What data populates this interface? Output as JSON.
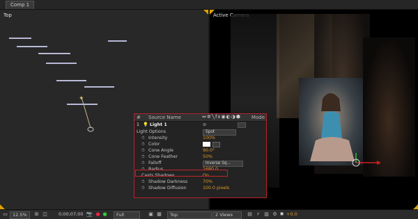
{
  "tab": {
    "label": "Comp 1"
  },
  "viewports": {
    "left_label": "Top",
    "right_label": "Active Camera"
  },
  "panel": {
    "header": {
      "num_col": "#",
      "name_col": "Source Name",
      "mode_col": "Mode"
    },
    "layer": {
      "index": "1",
      "name": "Light 1"
    },
    "rows": [
      {
        "label": "Light Options",
        "value": "Spot",
        "kind": "dropdown"
      },
      {
        "label": "Intensity",
        "value": "100%",
        "kind": "value"
      },
      {
        "label": "Color",
        "value": "",
        "kind": "color"
      },
      {
        "label": "Cone Angle",
        "value": "90.0°",
        "kind": "value"
      },
      {
        "label": "Cone Feather",
        "value": "50%",
        "kind": "value"
      },
      {
        "label": "Falloff",
        "value": "Inverse Sq...",
        "kind": "dropdown"
      },
      {
        "label": "Radius",
        "value": "1680.0",
        "kind": "value"
      },
      {
        "label": "Casts Shadows",
        "value": "On",
        "kind": "value"
      },
      {
        "label": "Shadow Darkness",
        "value": "70%",
        "kind": "value"
      },
      {
        "label": "Shadow Diffusion",
        "value": "100.0 pixels",
        "kind": "value"
      }
    ]
  },
  "toolbar": {
    "zoom": "12.5%",
    "timecode": "0;00;07;00",
    "resolution": "Full",
    "view": "Top",
    "layout": "2 Views",
    "exposure": "+0.0"
  },
  "colors": {
    "accent": "#e29a2a",
    "highlight": "#c4242c",
    "corner": "#e0a000"
  }
}
